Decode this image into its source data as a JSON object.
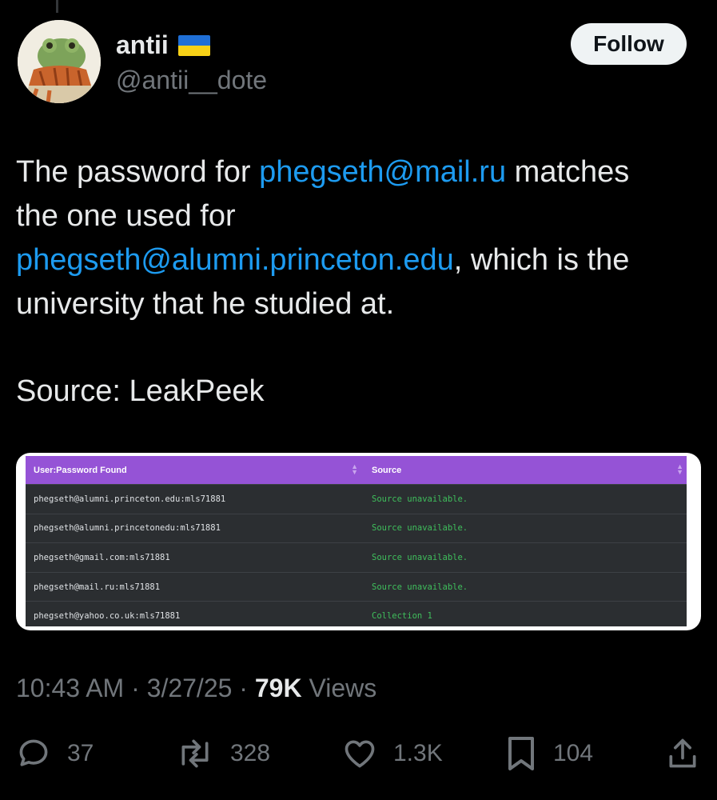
{
  "author": {
    "name": "antii",
    "handle": "@antii__dote",
    "flag_icon": "ukraine-flag-icon"
  },
  "follow_label": "Follow",
  "tweet": {
    "line1_before": "The password for ",
    "line1_link": "phegseth@mail.ru",
    "line1_after": " matches",
    "line2": "the one used for",
    "line3_link": "phegseth@alumni.princeton.edu",
    "line3_after": ", which is the",
    "line4": "university that he studied at.",
    "source": "Source: LeakPeek",
    "link_color": "#1d9bf0"
  },
  "media_table": {
    "headers": [
      "User:Password Found",
      "Source"
    ],
    "header_color": "#9553d6",
    "rows": [
      {
        "cred": "phegseth@alumni.princeton.edu:mls71881",
        "source": "Source unavailable."
      },
      {
        "cred": "phegseth@alumni.princetonedu:mls71881",
        "source": "Source unavailable."
      },
      {
        "cred": "phegseth@gmail.com:mls71881",
        "source": "Source unavailable."
      },
      {
        "cred": "phegseth@mail.ru:mls71881",
        "source": "Source unavailable."
      },
      {
        "cred": "phegseth@yahoo.co.uk:mls71881",
        "source": "Collection 1"
      }
    ]
  },
  "meta": {
    "time": "10:43 AM",
    "date": "3/27/25",
    "views_count": "79K",
    "views_label": "Views"
  },
  "actions": {
    "replies": "37",
    "reposts": "328",
    "likes": "1.3K",
    "bookmarks": "104"
  }
}
